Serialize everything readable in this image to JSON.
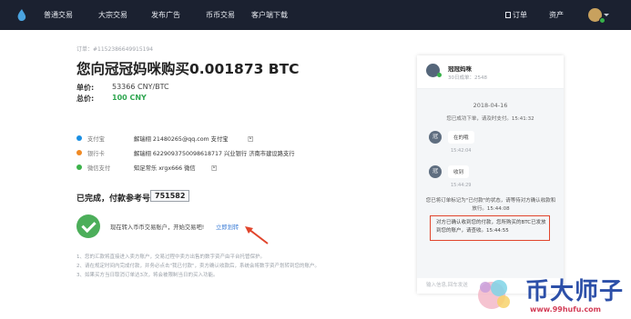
{
  "nav": {
    "items": [
      "普通交易",
      "大宗交易",
      "发布广告",
      "币币交易",
      "客户端下载"
    ],
    "orders_label": "订单",
    "assets_label": "资产"
  },
  "order": {
    "id": "订单：#1152386649915194",
    "title": "您向冠冠妈咪购买0.001873 BTC",
    "price_label": "单价:",
    "price_value": "53366 CNY/BTC",
    "total_label": "总价:",
    "total_value": "100 CNY"
  },
  "payments": [
    {
      "name": "支付宝",
      "detail": "解瑞栩  21480265@qq.com  支付宝",
      "qr": "凹",
      "color": "#1a8fe3"
    },
    {
      "name": "银行卡",
      "detail": "解瑞栩  6229093750098618717  兴业银行  济南市建设路支行",
      "qr": "",
      "color": "#f08a24"
    },
    {
      "name": "微信支付",
      "detail": "知足常乐  xrgx666  微信",
      "qr": "凹",
      "color": "#3cb24a"
    }
  ],
  "status": {
    "done_label": "已完成，付款参考号：",
    "ref_number": "751582",
    "transfer_text": "现在转入币币交易账户，开始交易吧!",
    "transfer_link": "立即划转"
  },
  "notes": [
    "1、您的汇款将直接进入卖方账户，交易过程中卖方出售的数字资产由平台托管保护。",
    "2、请在规定时间内完成付款，并务必点击\"我已付款\"，卖方确认收款后，系统会将数字资产划转到您的账户。",
    "3、如果买方当日取消订单达3次，将会被限制当日的买入功能。"
  ],
  "chat": {
    "name": "冠冠妈咪",
    "orders": "30日成单：2548",
    "date": "2018-04-16",
    "sys1": "您已成功下单，请及时支付。15:41:32",
    "messages": [
      {
        "avatar": "冠",
        "text": "在的哦",
        "time": "15:42:04"
      },
      {
        "avatar": "冠",
        "text": "收到",
        "time": "15:44:29"
      }
    ],
    "sys2": "您已将订单标记为\"已付款\"的状态，请等待对方确认收款和放行。15:44:08",
    "alert": "对方已确认收到您的付款，您所购买的BTC已发放到您的账户，请查收。15:44:55",
    "input_placeholder": "输入信息,回车发送"
  },
  "watermark": {
    "text": "币大师子",
    "url": "www.99hufu.com"
  }
}
